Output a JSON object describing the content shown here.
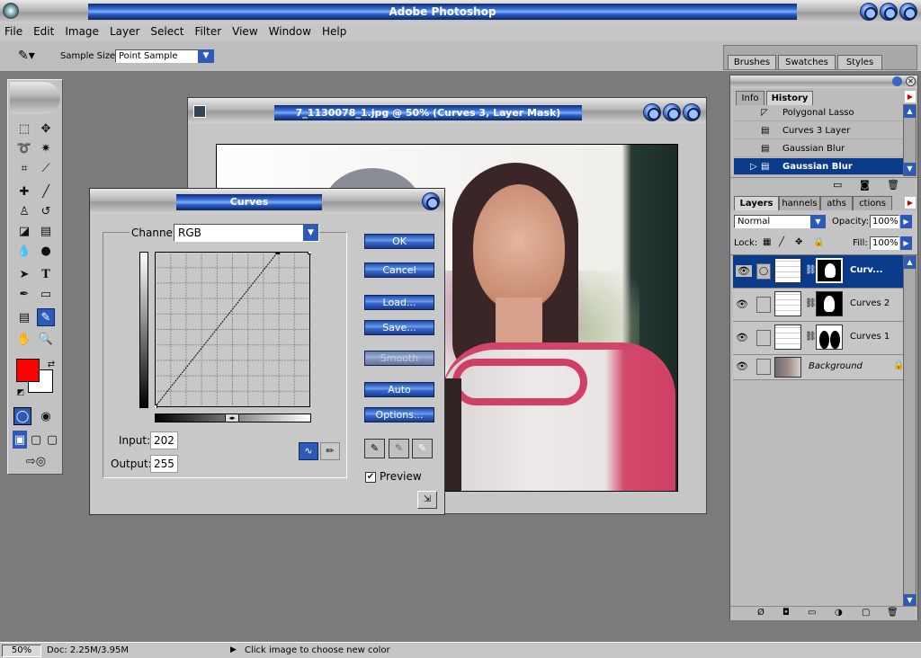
{
  "app": {
    "title": "Adobe Photoshop"
  },
  "menu": [
    "File",
    "Edit",
    "Image",
    "Layer",
    "Select",
    "Filter",
    "View",
    "Window",
    "Help"
  ],
  "options_bar": {
    "sample_size_label": "Sample Size:",
    "sample_size_value": "Point Sample"
  },
  "palette_well": {
    "tabs": [
      "Brushes",
      "Swatches",
      "Styles"
    ]
  },
  "document": {
    "title": "7_1130078_1.jpg @ 50% (Curves 3, Layer Mask)"
  },
  "curves": {
    "title": "Curves",
    "channel_label": "Channel:",
    "channel_value": "RGB",
    "input_label": "Input:",
    "input_value": "202",
    "output_label": "Output:",
    "output_value": "255",
    "buttons": {
      "ok": "OK",
      "cancel": "Cancel",
      "load": "Load...",
      "save": "Save...",
      "smooth": "Smooth",
      "auto": "Auto",
      "options": "Options..."
    },
    "preview_label": "Preview",
    "preview_checked": true,
    "curve_points": [
      [
        0,
        0
      ],
      [
        202,
        255
      ],
      [
        255,
        255
      ]
    ]
  },
  "history": {
    "tabs": [
      "Info",
      "History"
    ],
    "items": [
      "Polygonal Lasso",
      "Curves 3 Layer",
      "Gaussian Blur",
      "Gaussian Blur"
    ],
    "selected_index": 3
  },
  "layers": {
    "tabs": [
      "Layers",
      "Channels",
      "Paths",
      "Actions"
    ],
    "tab_visible": [
      "Layers",
      "hannels",
      "aths",
      "ctions"
    ],
    "blend_mode": "Normal",
    "opacity_label": "Opacity:",
    "opacity_value": "100%",
    "lock_label": "Lock:",
    "fill_label": "Fill:",
    "fill_value": "100%",
    "items": [
      {
        "name": "Curv...",
        "selected": true
      },
      {
        "name": "Curves 2",
        "selected": false
      },
      {
        "name": "Curves 1",
        "selected": false
      },
      {
        "name": "Background",
        "selected": false
      }
    ]
  },
  "colors": {
    "foreground": "#ff0000",
    "background": "#ffffff",
    "accent": "#0a3a8a"
  },
  "status": {
    "zoom": "50%",
    "doc": "Doc: 2.25M/3.95M",
    "hint": "Click image to choose new color"
  }
}
